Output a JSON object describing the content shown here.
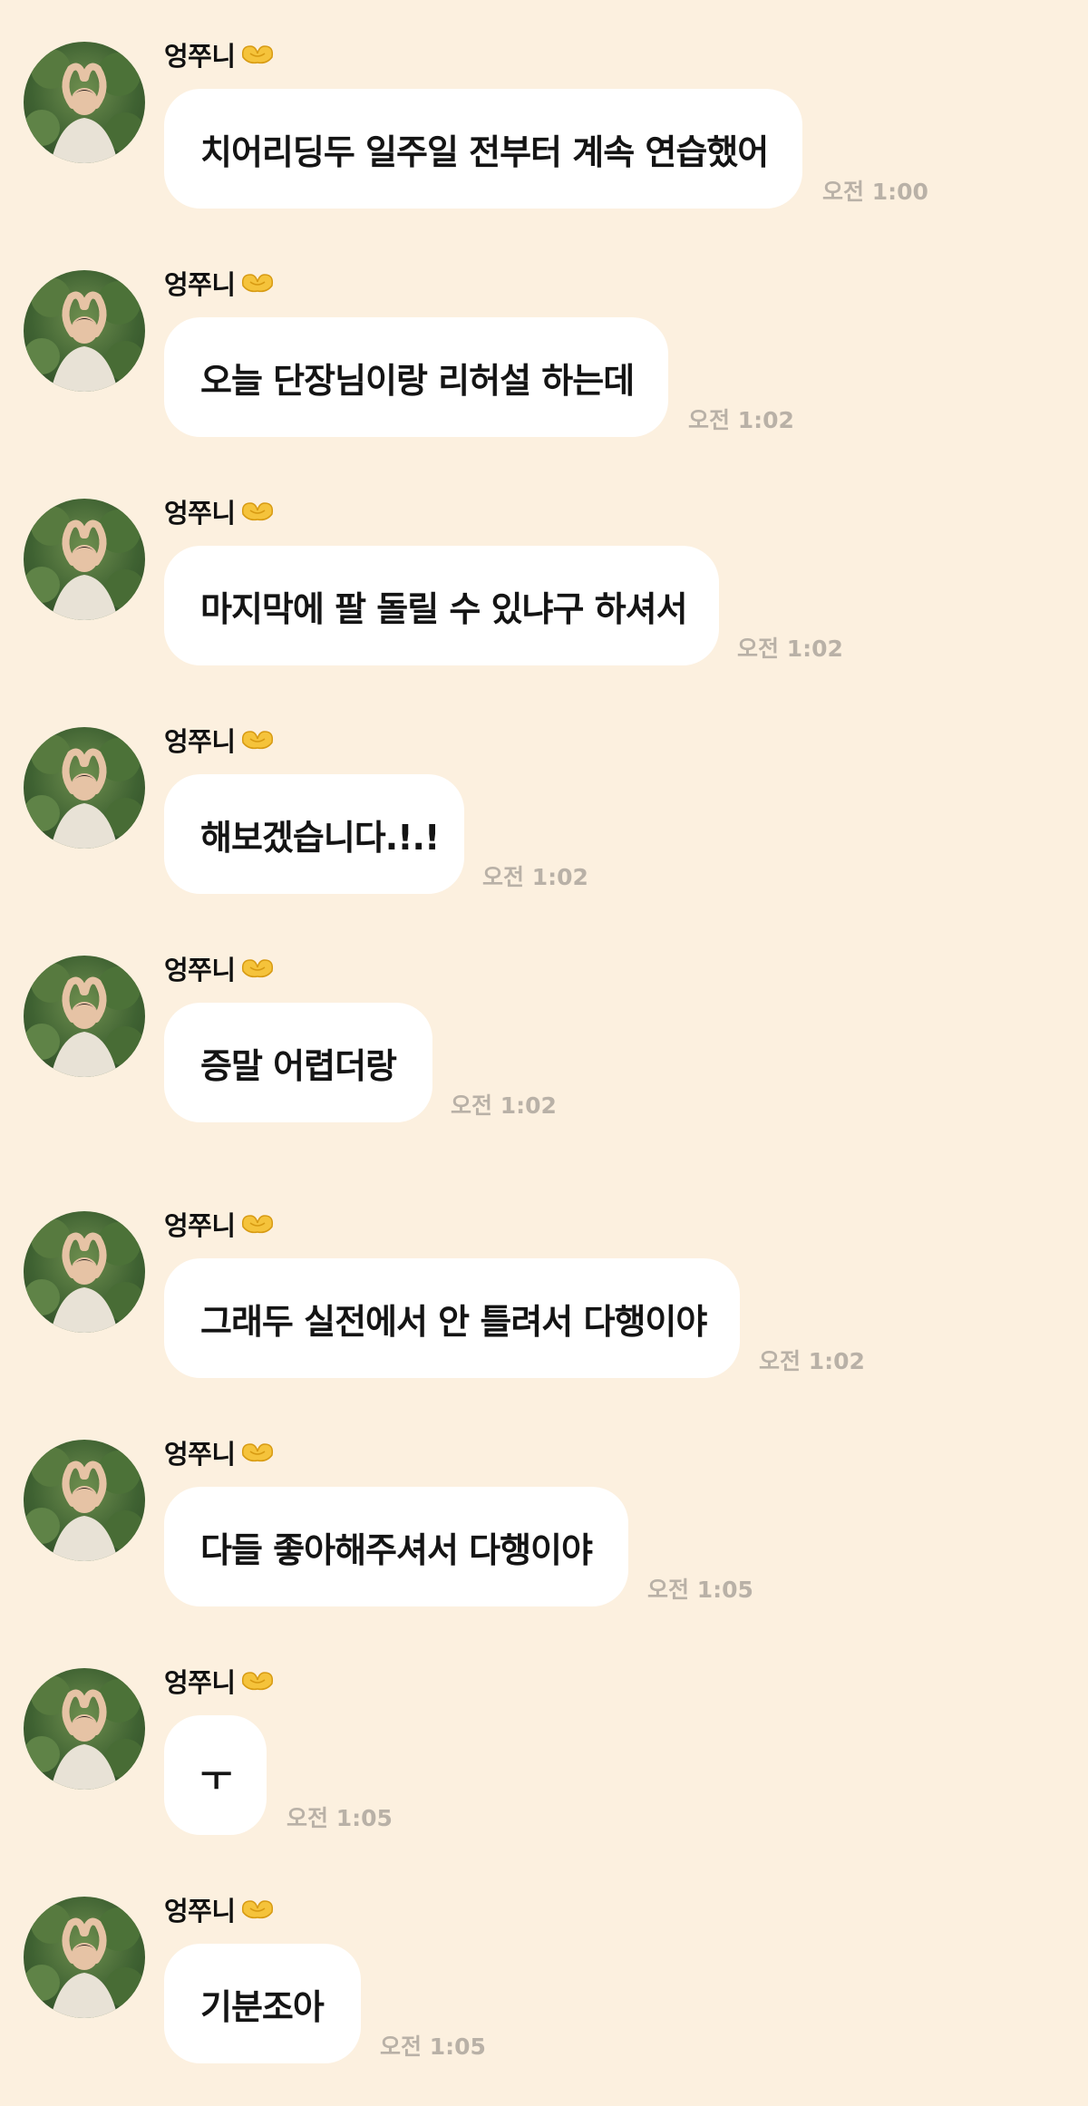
{
  "colors": {
    "background": "#fcf0df",
    "bubble": "#ffffff",
    "text": "#141414",
    "timestamp": "#b9b1a7"
  },
  "messages": [
    {
      "sender": "엉쭈니",
      "emoji": "heart-hands-icon",
      "text": "치어리딩두 일주일 전부터 계속 연습했어",
      "time": "오전 1:00"
    },
    {
      "sender": "엉쭈니",
      "emoji": "heart-hands-icon",
      "text": "오늘 단장님이랑 리허설 하는데",
      "time": "오전 1:02"
    },
    {
      "sender": "엉쭈니",
      "emoji": "heart-hands-icon",
      "text": "마지막에 팔 돌릴 수 있냐구 하셔서",
      "time": "오전 1:02"
    },
    {
      "sender": "엉쭈니",
      "emoji": "heart-hands-icon",
      "text": "해보겠습니다.!.!",
      "time": "오전 1:02"
    },
    {
      "sender": "엉쭈니",
      "emoji": "heart-hands-icon",
      "text": "증말 어렵더랑",
      "time": "오전 1:02"
    },
    {
      "sender": "엉쭈니",
      "emoji": "heart-hands-icon",
      "text": "그래두 실전에서 안 틀려서 다행이야",
      "time": "오전 1:02"
    },
    {
      "sender": "엉쭈니",
      "emoji": "heart-hands-icon",
      "text": "다들 좋아해주셔서 다행이야",
      "time": "오전 1:05"
    },
    {
      "sender": "엉쭈니",
      "emoji": "heart-hands-icon",
      "text": "ㅜ",
      "time": "오전 1:05"
    },
    {
      "sender": "엉쭈니",
      "emoji": "heart-hands-icon",
      "text": "기분조아",
      "time": "오전 1:05"
    }
  ]
}
